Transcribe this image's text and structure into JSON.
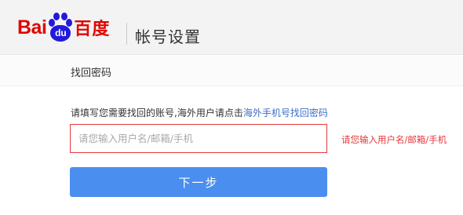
{
  "brand": {
    "logo_text_en": "Bai",
    "logo_paw_text": "du",
    "logo_text_cn": "百度",
    "color_red": "#e10601",
    "color_blue": "#2319dc"
  },
  "header": {
    "title": "帐号设置"
  },
  "tabbar": {
    "current": "找回密码"
  },
  "form": {
    "instruction_text": "请填写您需要找回的账号,海外用户请点击",
    "instruction_link": "海外手机号找回密码",
    "account_input": {
      "value": "",
      "placeholder": "请您输入用户名/邮箱/手机"
    },
    "error_message": "请您输入用户名/邮箱/手机",
    "next_label": "下一步",
    "accent_color": "#4a8ef0",
    "error_color": "#e4393c"
  }
}
